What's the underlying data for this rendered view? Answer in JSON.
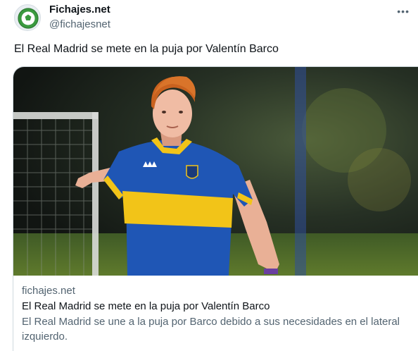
{
  "author": {
    "name": "Fichajes.net",
    "handle": "@fichajesnet",
    "avatar_icon": "soccer-ball-logo-icon",
    "more_icon": "more-dots-icon"
  },
  "tweet": {
    "text": "El Real Madrid se mete en la puja por Valentín Barco"
  },
  "card": {
    "domain": "fichajes.net",
    "title": "El Real Madrid se mete en la puja por Valentín Barco",
    "description": "El Real Madrid se une a la puja por Barco debido a sus necesidades en el lateral izquierdo.",
    "image": "footballer-photo"
  },
  "colors": {
    "text_primary": "#0f1419",
    "text_secondary": "#536471",
    "border": "#cfd9de",
    "logo_green": "#3a9a3f",
    "kit_blue": "#1f56b5",
    "kit_yellow": "#f2c418"
  }
}
